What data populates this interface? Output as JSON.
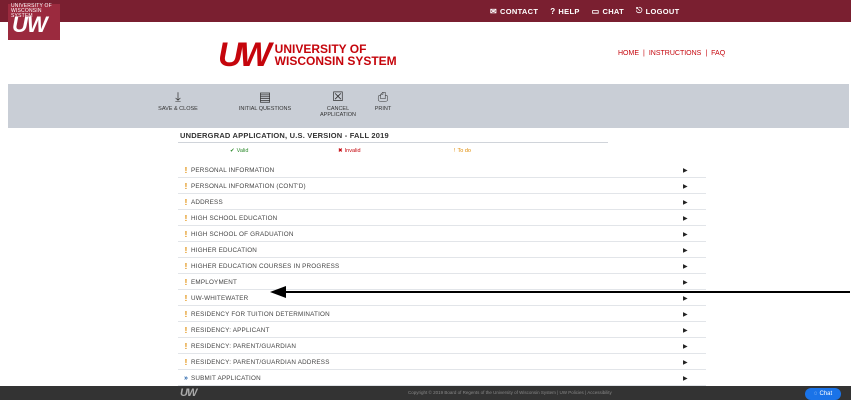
{
  "corner_logo": {
    "small_text": "UNIVERSITY OF WISCONSIN SYSTEM",
    "mark": "UW"
  },
  "top_links": [
    {
      "icon": "envelope-icon",
      "glyph": "✉",
      "label": "CONTACT"
    },
    {
      "icon": "help-icon",
      "glyph": "?",
      "label": "HELP"
    },
    {
      "icon": "chat-icon",
      "glyph": "▭",
      "label": "CHAT"
    },
    {
      "icon": "logout-icon",
      "glyph": "⎋",
      "label": "LOGOUT"
    }
  ],
  "brand": {
    "mark": "UW",
    "line1": "UNIVERSITY OF",
    "line2": "WISCONSIN SYSTEM"
  },
  "header_nav": [
    "HOME",
    "|",
    "INSTRUCTIONS",
    "|",
    "FAQ"
  ],
  "toolbar": [
    {
      "icon": "save-icon",
      "glyph": "⤓",
      "label": "SAVE & CLOSE"
    },
    {
      "icon": "questions-icon",
      "glyph": "▤",
      "label": "INITIAL QUESTIONS"
    },
    {
      "icon": "cancel-icon",
      "glyph": "☒",
      "label": "CANCEL APPLICATION"
    },
    {
      "icon": "print-icon",
      "glyph": "⎙",
      "label": "PRINT"
    }
  ],
  "application_title": "UNDERGRAD APPLICATION, U.S. VERSION - FALL 2019",
  "legend": {
    "valid": {
      "glyph": "✔",
      "label": "Valid"
    },
    "invalid": {
      "glyph": "✖",
      "label": "Invalid"
    },
    "todo": {
      "glyph": "!",
      "label": "To do"
    }
  },
  "sections": [
    {
      "mark": "!",
      "label": "PERSONAL INFORMATION"
    },
    {
      "mark": "!",
      "label": "PERSONAL INFORMATION (CONT'D)"
    },
    {
      "mark": "!",
      "label": "ADDRESS"
    },
    {
      "mark": "!",
      "label": "HIGH SCHOOL EDUCATION"
    },
    {
      "mark": "!",
      "label": "HIGH SCHOOL OF GRADUATION"
    },
    {
      "mark": "!",
      "label": "HIGHER EDUCATION"
    },
    {
      "mark": "!",
      "label": "HIGHER EDUCATION COURSES IN PROGRESS"
    },
    {
      "mark": "!",
      "label": "EMPLOYMENT"
    },
    {
      "mark": "!",
      "label": "UW-WHITEWATER"
    },
    {
      "mark": "!",
      "label": "RESIDENCY FOR TUITION DETERMINATION"
    },
    {
      "mark": "!",
      "label": "RESIDENCY: APPLICANT"
    },
    {
      "mark": "!",
      "label": "RESIDENCY: PARENT/GUARDIAN"
    },
    {
      "mark": "!",
      "label": "RESIDENCY: PARENT/GUARDIAN ADDRESS"
    },
    {
      "mark": "»",
      "label": "SUBMIT APPLICATION"
    }
  ],
  "chevron": "▶",
  "footer": {
    "logo": "UW",
    "logo_text": "UNIVERSITY OF WISCONSIN SYSTEM",
    "copyright": "Copyright © 2019 Board of Regents of the University of Wisconsin System | UW Policies | Accessibility"
  },
  "chat_button": {
    "glyph": "◌",
    "label": "Chat"
  },
  "colors": {
    "maroon": "#7a1f30",
    "uw_red": "#c5050c",
    "toolbar_gray": "#c9ced6",
    "todo_orange": "#e08a00"
  }
}
